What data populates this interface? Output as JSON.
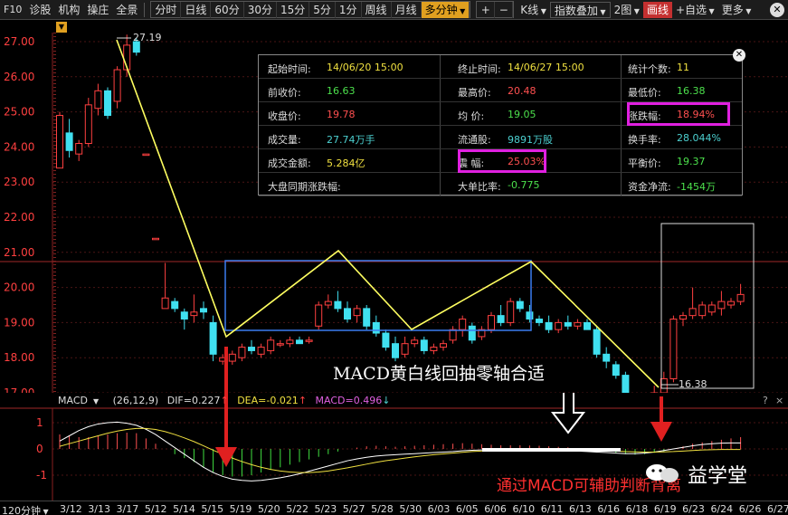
{
  "toolbar": {
    "f10": "F10",
    "left_items": [
      "诊股",
      "机构",
      "操庄",
      "全景"
    ],
    "periods": [
      "分时",
      "日线",
      "60分",
      "30分",
      "15分",
      "5分",
      "1分",
      "周线",
      "月线",
      "多分钟"
    ],
    "active_period": "多分钟",
    "plus": "+",
    "minus": "−",
    "k_label": "K线",
    "indicator": "指数叠加",
    "layout": "2图",
    "draw": "画线",
    "watchlist": "+自选",
    "more": "更多",
    "close": "✕"
  },
  "info_box": {
    "rows": [
      [
        {
          "label": "起始时间:",
          "value": "14/06/20 15:00",
          "color": "yellow"
        },
        {
          "label": "终止时间:",
          "value": "14/06/27 15:00",
          "color": "yellow"
        },
        {
          "label": "统计个数:",
          "value": "11",
          "color": "yellow"
        }
      ],
      [
        {
          "label": "前收价:",
          "value": "16.63",
          "color": "green"
        },
        {
          "label": "最高价:",
          "value": "20.48",
          "color": "red"
        },
        {
          "label": "最低价:",
          "value": "16.38",
          "color": "green"
        }
      ],
      [
        {
          "label": "收盘价:",
          "value": "19.78",
          "color": "red"
        },
        {
          "label": "均  价:",
          "value": "19.05",
          "color": "green"
        },
        {
          "label": "涨跌幅:",
          "value": "18.94%",
          "color": "red"
        }
      ],
      [
        {
          "label": "成交量:",
          "value": "27.74万手",
          "color": "cyan"
        },
        {
          "label": "流通股:",
          "value": "9891万股",
          "color": "cyan"
        },
        {
          "label": "换手率:",
          "value": "28.044%",
          "color": "cyan"
        }
      ],
      [
        {
          "label": "成交金额:",
          "value": "5.284亿",
          "color": "yellow"
        },
        {
          "label": "震  幅:",
          "value": "25.03%",
          "color": "red"
        },
        {
          "label": "平衡价:",
          "value": "19.37",
          "color": "green"
        }
      ],
      [
        {
          "label": "大盘同期涨跌幅:",
          "value": "",
          "color": "yellow"
        },
        {
          "label": "大单比率:",
          "value": "-0.775",
          "color": "green"
        },
        {
          "label": "资金净流:",
          "value": "-1454万",
          "color": "green"
        }
      ]
    ],
    "close": "✕"
  },
  "price_axis": {
    "ticks": [
      "27.00",
      "26.00",
      "25.00",
      "24.00",
      "23.00",
      "22.00",
      "21.00",
      "20.00",
      "19.00",
      "18.00",
      "17.00"
    ],
    "high_label": "27.19",
    "low_label": "16.38"
  },
  "macd": {
    "name": "MACD",
    "params": "(26,12,9)",
    "dif": "DIF=0.227",
    "dea": "DEA=-0.021",
    "macd": "MACD=0.496",
    "ticks": [
      "1",
      "0",
      "-1"
    ],
    "help": "?",
    "close": "×"
  },
  "annotations": {
    "main": "MACD黄白线回抽零轴合适",
    "bottom": "通过MACD可辅助判断背离",
    "watermark": "益学堂"
  },
  "x_axis": {
    "period": "120分钟",
    "dates": [
      "3/12",
      "3/13",
      "3/17",
      "5/12",
      "5/14",
      "5/15",
      "5/19",
      "5/20",
      "5/22",
      "5/23",
      "5/27",
      "5/28",
      "5/30",
      "6/03",
      "6/05",
      "6/06",
      "6/10",
      "6/11",
      "6/13",
      "6/16",
      "6/18",
      "6/19",
      "6/23",
      "6/24",
      "6/26",
      "6/27"
    ]
  },
  "colors": {
    "up": "#ff4040",
    "down": "#40e0f0",
    "yellow_line": "#ffff60",
    "box_blue": "#3a7cf0",
    "highlight": "#e020e0",
    "arrow_red": "#e02020"
  },
  "candles": [
    {
      "o": 23.4,
      "h": 25.0,
      "l": 23.4,
      "c": 24.9
    },
    {
      "o": 24.4,
      "h": 24.8,
      "l": 23.7,
      "c": 23.9
    },
    {
      "o": 23.8,
      "h": 24.2,
      "l": 23.6,
      "c": 24.1
    },
    {
      "o": 24.1,
      "h": 25.4,
      "l": 24.0,
      "c": 25.2
    },
    {
      "o": 25.1,
      "h": 25.8,
      "l": 24.9,
      "c": 25.6
    },
    {
      "o": 25.6,
      "h": 25.7,
      "l": 24.8,
      "c": 24.9
    },
    {
      "o": 25.3,
      "h": 26.3,
      "l": 25.1,
      "c": 26.2
    },
    {
      "o": 26.2,
      "h": 27.2,
      "l": 26.0,
      "c": 26.9
    },
    {
      "o": 27.0,
      "h": 27.1,
      "l": 26.6,
      "c": 26.7
    },
    {
      "o": 23.8,
      "h": 23.8,
      "l": 23.8,
      "c": 23.8
    },
    {
      "o": 21.4,
      "h": 21.4,
      "l": 21.4,
      "c": 21.4
    },
    {
      "o": 19.4,
      "h": 20.7,
      "l": 19.4,
      "c": 19.7
    },
    {
      "o": 19.6,
      "h": 19.7,
      "l": 19.3,
      "c": 19.4
    },
    {
      "o": 19.3,
      "h": 19.4,
      "l": 18.8,
      "c": 19.1
    },
    {
      "o": 19.2,
      "h": 19.8,
      "l": 19.0,
      "c": 19.3
    },
    {
      "o": 19.4,
      "h": 19.6,
      "l": 19.1,
      "c": 19.3
    },
    {
      "o": 19.0,
      "h": 19.2,
      "l": 17.9,
      "c": 18.1
    },
    {
      "o": 17.9,
      "h": 18.1,
      "l": 17.8,
      "c": 18.0
    },
    {
      "o": 17.9,
      "h": 18.2,
      "l": 17.8,
      "c": 18.1
    },
    {
      "o": 18.0,
      "h": 18.4,
      "l": 17.9,
      "c": 18.3
    },
    {
      "o": 18.3,
      "h": 18.5,
      "l": 18.1,
      "c": 18.2
    },
    {
      "o": 18.1,
      "h": 18.4,
      "l": 18.0,
      "c": 18.3
    },
    {
      "o": 18.2,
      "h": 18.6,
      "l": 18.1,
      "c": 18.5
    },
    {
      "o": 18.4,
      "h": 18.5,
      "l": 18.3,
      "c": 18.4
    },
    {
      "o": 18.4,
      "h": 18.6,
      "l": 18.3,
      "c": 18.5
    },
    {
      "o": 18.5,
      "h": 18.6,
      "l": 18.4,
      "c": 18.4
    },
    {
      "o": 18.5,
      "h": 18.6,
      "l": 18.4,
      "c": 18.5
    },
    {
      "o": 18.9,
      "h": 19.6,
      "l": 18.8,
      "c": 19.5
    },
    {
      "o": 19.5,
      "h": 19.8,
      "l": 19.4,
      "c": 19.6
    },
    {
      "o": 19.6,
      "h": 19.9,
      "l": 19.3,
      "c": 19.4
    },
    {
      "o": 19.4,
      "h": 19.6,
      "l": 19.0,
      "c": 19.1
    },
    {
      "o": 19.2,
      "h": 19.5,
      "l": 19.0,
      "c": 19.4
    },
    {
      "o": 19.4,
      "h": 19.5,
      "l": 18.8,
      "c": 18.9
    },
    {
      "o": 19.0,
      "h": 19.2,
      "l": 18.6,
      "c": 18.7
    },
    {
      "o": 18.7,
      "h": 18.8,
      "l": 18.2,
      "c": 18.3
    },
    {
      "o": 18.4,
      "h": 18.6,
      "l": 17.9,
      "c": 18.0
    },
    {
      "o": 18.1,
      "h": 18.6,
      "l": 18.0,
      "c": 18.4
    },
    {
      "o": 18.4,
      "h": 18.6,
      "l": 18.3,
      "c": 18.5
    },
    {
      "o": 18.5,
      "h": 18.6,
      "l": 18.1,
      "c": 18.2
    },
    {
      "o": 18.2,
      "h": 18.4,
      "l": 18.1,
      "c": 18.3
    },
    {
      "o": 18.3,
      "h": 18.5,
      "l": 18.2,
      "c": 18.4
    },
    {
      "o": 18.5,
      "h": 18.9,
      "l": 18.4,
      "c": 18.8
    },
    {
      "o": 18.8,
      "h": 19.2,
      "l": 18.6,
      "c": 19.1
    },
    {
      "o": 18.9,
      "h": 19.0,
      "l": 18.4,
      "c": 18.5
    },
    {
      "o": 18.6,
      "h": 18.9,
      "l": 18.5,
      "c": 18.8
    },
    {
      "o": 18.8,
      "h": 19.3,
      "l": 18.7,
      "c": 19.2
    },
    {
      "o": 19.2,
      "h": 19.5,
      "l": 18.9,
      "c": 19.0
    },
    {
      "o": 19.0,
      "h": 19.7,
      "l": 18.9,
      "c": 19.6
    },
    {
      "o": 19.6,
      "h": 19.7,
      "l": 19.3,
      "c": 19.4
    },
    {
      "o": 19.3,
      "h": 19.5,
      "l": 19.0,
      "c": 19.1
    },
    {
      "o": 19.1,
      "h": 19.2,
      "l": 18.9,
      "c": 19.0
    },
    {
      "o": 19.0,
      "h": 19.2,
      "l": 18.7,
      "c": 18.8
    },
    {
      "o": 18.8,
      "h": 19.1,
      "l": 18.7,
      "c": 19.0
    },
    {
      "o": 19.0,
      "h": 19.2,
      "l": 18.8,
      "c": 18.9
    },
    {
      "o": 18.9,
      "h": 19.1,
      "l": 18.8,
      "c": 19.0
    },
    {
      "o": 19.0,
      "h": 19.1,
      "l": 18.8,
      "c": 18.8
    },
    {
      "o": 18.8,
      "h": 18.9,
      "l": 18.0,
      "c": 18.1
    },
    {
      "o": 18.1,
      "h": 18.3,
      "l": 17.7,
      "c": 17.9
    },
    {
      "o": 17.8,
      "h": 17.9,
      "l": 17.4,
      "c": 17.5
    },
    {
      "o": 17.5,
      "h": 17.6,
      "l": 16.6,
      "c": 16.7
    },
    {
      "o": 16.7,
      "h": 16.9,
      "l": 16.4,
      "c": 16.6
    },
    {
      "o": 16.5,
      "h": 16.8,
      "l": 16.4,
      "c": 16.7
    },
    {
      "o": 16.8,
      "h": 17.2,
      "l": 16.7,
      "c": 17.0
    },
    {
      "o": 17.0,
      "h": 17.6,
      "l": 16.9,
      "c": 17.4
    },
    {
      "o": 17.4,
      "h": 19.2,
      "l": 17.3,
      "c": 19.1
    },
    {
      "o": 19.1,
      "h": 19.3,
      "l": 18.9,
      "c": 19.2
    },
    {
      "o": 19.2,
      "h": 20.0,
      "l": 19.1,
      "c": 19.4
    },
    {
      "o": 19.2,
      "h": 19.6,
      "l": 19.1,
      "c": 19.5
    },
    {
      "o": 19.3,
      "h": 19.6,
      "l": 19.2,
      "c": 19.5
    },
    {
      "o": 19.4,
      "h": 19.9,
      "l": 19.2,
      "c": 19.6
    },
    {
      "o": 19.5,
      "h": 19.7,
      "l": 19.4,
      "c": 19.6
    },
    {
      "o": 19.6,
      "h": 20.1,
      "l": 19.5,
      "c": 19.8
    }
  ],
  "macd_series": {
    "hist": [
      0.55,
      0.5,
      0.45,
      0.45,
      0.5,
      0.55,
      0.6,
      0.62,
      0.6,
      0.4,
      0.2,
      0.0,
      -0.2,
      -0.35,
      -0.5,
      -0.7,
      -0.9,
      -1.0,
      -1.05,
      -1.05,
      -1.0,
      -0.9,
      -0.8,
      -0.7,
      -0.6,
      -0.5,
      -0.4,
      -0.3,
      -0.2,
      -0.1,
      0.0,
      0.05,
      0.1,
      0.12,
      0.1,
      0.08,
      0.1,
      0.12,
      0.14,
      0.16,
      0.18,
      0.2,
      0.22,
      0.2,
      0.18,
      0.16,
      0.14,
      0.14,
      0.14,
      0.13,
      0.12,
      0.1,
      0.08,
      0.06,
      0.03,
      0.0,
      -0.05,
      -0.1,
      -0.15,
      -0.2,
      -0.22,
      -0.2,
      -0.15,
      -0.1,
      0.0,
      0.1,
      0.2,
      0.25,
      0.3,
      0.35,
      0.4,
      0.45
    ],
    "dif": [
      0.3,
      0.5,
      0.7,
      0.85,
      0.95,
      1.0,
      1.02,
      0.98,
      0.9,
      0.75,
      0.55,
      0.3,
      0.05,
      -0.2,
      -0.45,
      -0.7,
      -0.9,
      -1.05,
      -1.15,
      -1.2,
      -1.22,
      -1.2,
      -1.15,
      -1.1,
      -1.03,
      -0.95,
      -0.85,
      -0.75,
      -0.65,
      -0.55,
      -0.45,
      -0.38,
      -0.32,
      -0.27,
      -0.24,
      -0.22,
      -0.2,
      -0.18,
      -0.16,
      -0.14,
      -0.12,
      -0.1,
      -0.07,
      -0.05,
      -0.04,
      -0.03,
      -0.02,
      -0.01,
      0.0,
      0.0,
      0.0,
      0.0,
      -0.02,
      -0.05,
      -0.08,
      -0.1,
      -0.12,
      -0.14,
      -0.16,
      -0.18,
      -0.18,
      -0.16,
      -0.12,
      -0.06,
      0.0,
      0.06,
      0.12,
      0.17,
      0.2,
      0.22,
      0.23,
      0.23
    ],
    "dea": [
      0.1,
      0.2,
      0.3,
      0.4,
      0.5,
      0.6,
      0.68,
      0.74,
      0.78,
      0.78,
      0.74,
      0.66,
      0.55,
      0.42,
      0.28,
      0.12,
      -0.05,
      -0.2,
      -0.35,
      -0.48,
      -0.6,
      -0.7,
      -0.78,
      -0.84,
      -0.88,
      -0.9,
      -0.9,
      -0.88,
      -0.84,
      -0.78,
      -0.72,
      -0.65,
      -0.58,
      -0.51,
      -0.45,
      -0.4,
      -0.35,
      -0.3,
      -0.26,
      -0.22,
      -0.19,
      -0.16,
      -0.13,
      -0.1,
      -0.08,
      -0.06,
      -0.05,
      -0.04,
      -0.03,
      -0.02,
      -0.01,
      0.0,
      0.0,
      -0.01,
      -0.02,
      -0.03,
      -0.04,
      -0.06,
      -0.08,
      -0.1,
      -0.11,
      -0.12,
      -0.12,
      -0.11,
      -0.1,
      -0.08,
      -0.06,
      -0.04,
      -0.03,
      -0.02,
      -0.02,
      -0.02
    ]
  }
}
